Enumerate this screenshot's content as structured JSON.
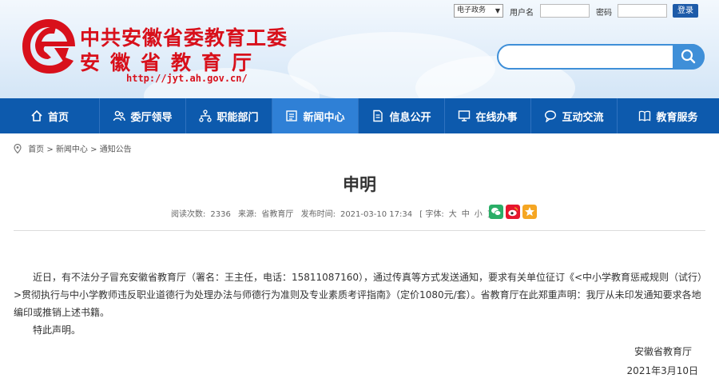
{
  "header": {
    "title_line1": "中共安徽省委教育工委",
    "title_line2": "安徽省教育厅",
    "url": "http://jyt.ah.gov.cn/"
  },
  "login": {
    "site_select": "电子政务",
    "username_label": "用户名",
    "password_label": "密码",
    "login_button": "登录"
  },
  "search": {
    "placeholder": ""
  },
  "nav": {
    "items": [
      {
        "label": "首页",
        "icon": "home-icon"
      },
      {
        "label": "委厅领导",
        "icon": "users-icon"
      },
      {
        "label": "职能部门",
        "icon": "org-chart-icon"
      },
      {
        "label": "新闻中心",
        "icon": "news-icon",
        "active": true
      },
      {
        "label": "信息公开",
        "icon": "document-icon"
      },
      {
        "label": "在线办事",
        "icon": "monitor-icon"
      },
      {
        "label": "互动交流",
        "icon": "chat-icon"
      },
      {
        "label": "教育服务",
        "icon": "book-icon"
      }
    ]
  },
  "breadcrumb": [
    "首页",
    "新闻中心",
    "通知公告"
  ],
  "article": {
    "title": "申明",
    "views_label": "阅读次数:",
    "views": "2336",
    "source_label": "来源:",
    "source": "省教育厅",
    "date_label": "发布时间:",
    "date": "2021-03-10 17:34",
    "font_label": "[ 字体:",
    "font_large": "大",
    "font_medium": "中",
    "font_small": "小",
    "font_close": "]",
    "paragraph1": "近日，有不法分子冒充安徽省教育厅（署名：王主任，电话：15811087160），通过传真等方式发送通知，要求有关单位征订《<中小学教育惩戒规则（试行）>贯彻执行与中小学教师违反职业道德行为处理办法与师德行为准则及专业素质考评指南》（定价1080元/套）。省教育厅在此郑重声明：我厅从未印发通知要求各地编印或推销上述书籍。",
    "paragraph2": "特此声明。",
    "signature_org": "安徽省教育厅",
    "signature_date": "2021年3月10日"
  },
  "colors": {
    "brand_red": "#d8101b",
    "nav_blue": "#0d5aad",
    "nav_active": "#2f80d6",
    "wechat_green": "#2aae67",
    "weibo_red": "#e6162d",
    "favorite_orange": "#f5a623"
  }
}
